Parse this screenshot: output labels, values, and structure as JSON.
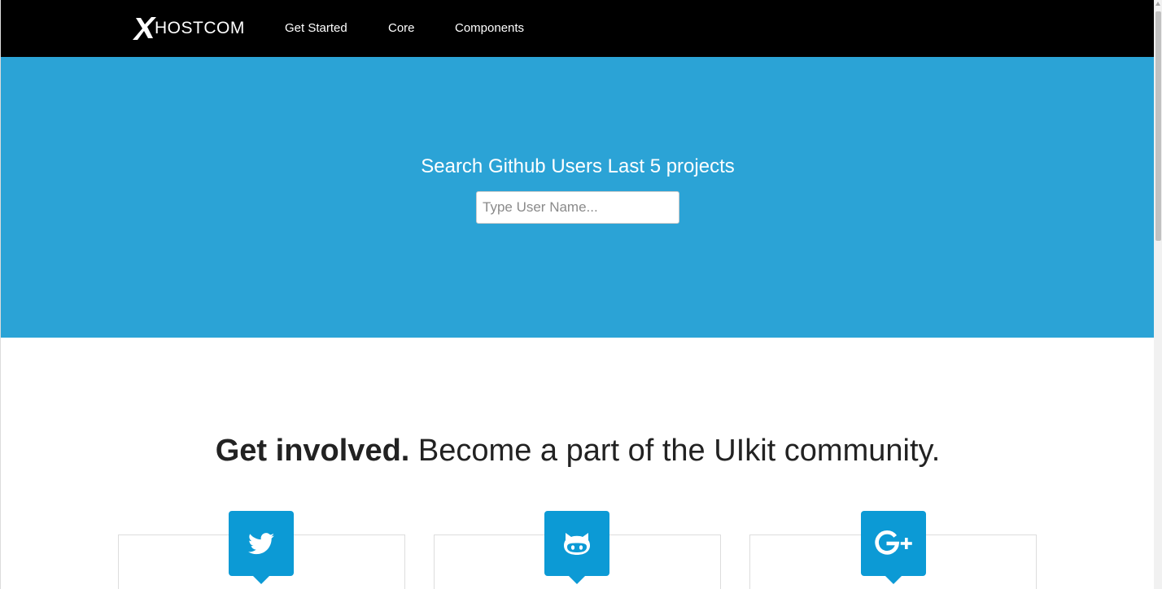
{
  "brand": {
    "name": "HOSTCOM",
    "mark": "X"
  },
  "nav": {
    "items": [
      {
        "label": "Get Started"
      },
      {
        "label": "Core"
      },
      {
        "label": "Components"
      }
    ]
  },
  "hero": {
    "title": "Search Github Users Last 5 projects",
    "search": {
      "placeholder": "Type User Name...",
      "value": ""
    },
    "background_color": "#2ba3d6"
  },
  "community": {
    "headline_bold": "Get involved.",
    "headline_rest": "Become a part of the UIkit community.",
    "cards": [
      {
        "icon": "twitter-icon"
      },
      {
        "icon": "github-icon"
      },
      {
        "icon": "google-plus-icon"
      }
    ],
    "accent_color": "#0c9ad5"
  }
}
